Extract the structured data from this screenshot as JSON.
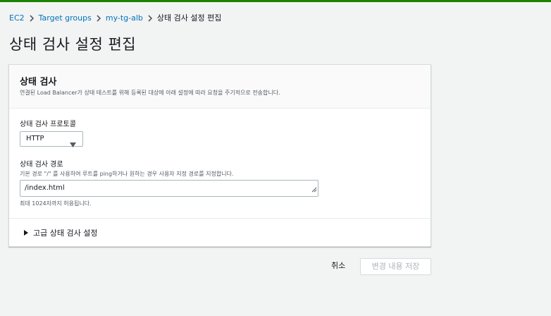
{
  "breadcrumb": {
    "items": [
      "EC2",
      "Target groups",
      "my-tg-alb"
    ],
    "current": "상태 검사 설정 편집"
  },
  "page": {
    "title": "상태 검사 설정 편집"
  },
  "health_check": {
    "title": "상태 검사",
    "description": "연결된 Load Balancer가 상태 테스트를 위해 등록된 대상에 아래 설정에 따라 요청을 주기적으로 전송합니다.",
    "protocol": {
      "label": "상태 검사 프로토콜",
      "value": "HTTP"
    },
    "path": {
      "label": "상태 검사 경로",
      "description": "기본 경로 \"/\" 를 사용하여 루트를 ping하거나 원하는 경우 사용자 지정 경로를 지정합니다.",
      "value": "/index.html",
      "hint": "최대 1024자까지 허용됩니다."
    },
    "advanced_label": "고급 상태 검사 설정"
  },
  "actions": {
    "cancel": "취소",
    "save": "변경 내용 저장"
  },
  "colors": {
    "accent_bar": "#1d8102",
    "link": "#0073bb",
    "disabled_text": "#aab7b8"
  }
}
